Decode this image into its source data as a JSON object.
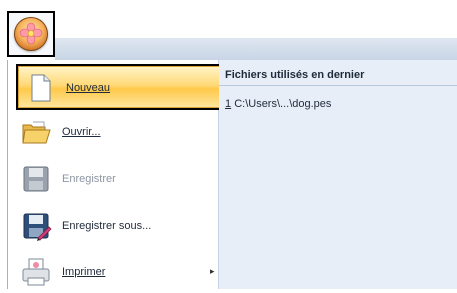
{
  "menu": {
    "items": [
      {
        "label": "Nouveau",
        "state": "highlighted"
      },
      {
        "label": "Ouvrir...",
        "state": "normal"
      },
      {
        "label": "Enregistrer",
        "state": "disabled"
      },
      {
        "label": "Enregistrer sous...",
        "state": "normal"
      },
      {
        "label": "Imprimer",
        "state": "normal",
        "submenu_arrow": "▸"
      }
    ]
  },
  "recent": {
    "header": "Fichiers utilisés en dernier",
    "items": [
      {
        "index": "1",
        "path": "C:\\Users\\...\\dog.pes"
      }
    ]
  },
  "colors": {
    "highlight": "#ffd978",
    "recent_panel": "#e7eef7",
    "titlebar": "#c8d5e6"
  }
}
